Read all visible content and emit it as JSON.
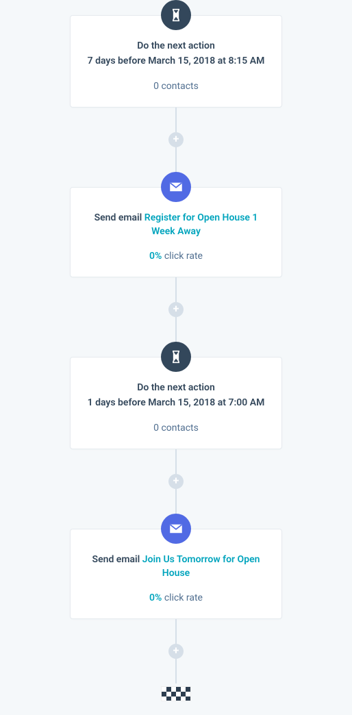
{
  "steps": [
    {
      "type": "delay",
      "title": "Do the next action",
      "detail": "7 days before March 15, 2018 at 8:15 AM",
      "meta_count": "0 contacts"
    },
    {
      "type": "email",
      "title_prefix": "Send email ",
      "link_text": "Register for Open House 1 Week Away",
      "rate_pct": "0%",
      "rate_label": " click rate"
    },
    {
      "type": "delay",
      "title": "Do the next action",
      "detail": "1 days before March 15, 2018 at 7:00 AM",
      "meta_count": "0 contacts"
    },
    {
      "type": "email",
      "title_prefix": "Send email ",
      "link_text": "Join Us Tomorrow for Open House",
      "rate_pct": "0%",
      "rate_label": " click rate"
    }
  ],
  "plus_glyph": "+"
}
